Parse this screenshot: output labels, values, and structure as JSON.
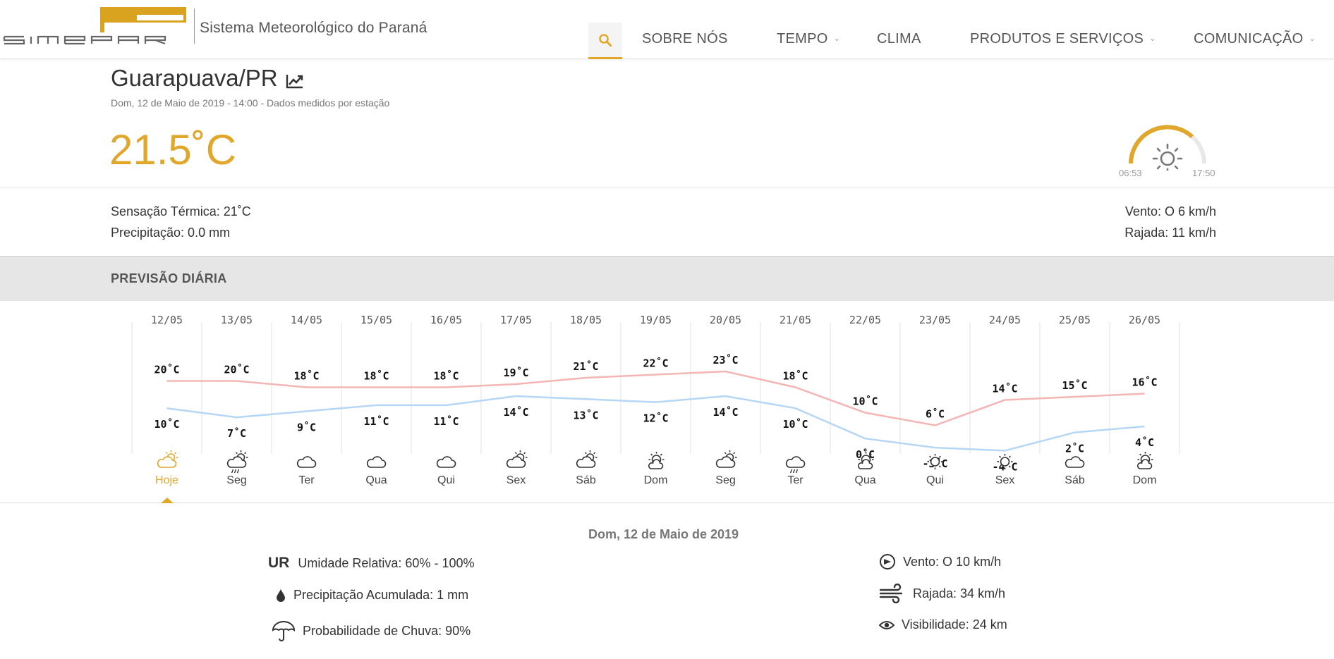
{
  "header": {
    "logo_text": "SIMEPAR",
    "logo_subtitle": "Sistema Meteorológico do Paraná",
    "nav": [
      {
        "label": "SOBRE NÓS",
        "dropdown": false
      },
      {
        "label": "TEMPO",
        "dropdown": true
      },
      {
        "label": "CLIMA",
        "dropdown": false
      },
      {
        "label": "PRODUTOS E SERVIÇOS",
        "dropdown": true
      },
      {
        "label": "COMUNICAÇÃO",
        "dropdown": true
      }
    ],
    "accent_color": "#e0a72b"
  },
  "current": {
    "city": "Guarapuava/PR",
    "subtitle": "Dom, 12 de Maio de 2019 - 14:00 - Dados medidos por estação",
    "temperature": "21.5˚C",
    "sunrise": "06:53",
    "sunset": "17:50",
    "sun_icon": "sun-icon",
    "feels_like": "Sensação Térmica: 21˚C",
    "precipitation": "Precipitação: 0.0 mm",
    "wind": "Vento: O 6 km/h",
    "gust": "Rajada: 11 km/h"
  },
  "forecast": {
    "title": "PREVISÃO DIÁRIA",
    "days": [
      {
        "date": "12/05",
        "max": "20˚C",
        "min": "10˚C",
        "label": "Hoje",
        "icon": "partly-cloudy-icon",
        "selected": true
      },
      {
        "date": "13/05",
        "max": "20˚C",
        "min": "7˚C",
        "label": "Seg",
        "icon": "sun-cloud-rain-icon",
        "selected": false
      },
      {
        "date": "14/05",
        "max": "18˚C",
        "min": "9˚C",
        "label": "Ter",
        "icon": "cloud-icon",
        "selected": false
      },
      {
        "date": "15/05",
        "max": "18˚C",
        "min": "11˚C",
        "label": "Qua",
        "icon": "cloud-icon",
        "selected": false
      },
      {
        "date": "16/05",
        "max": "18˚C",
        "min": "11˚C",
        "label": "Qui",
        "icon": "cloud-icon",
        "selected": false
      },
      {
        "date": "17/05",
        "max": "19˚C",
        "min": "14˚C",
        "label": "Sex",
        "icon": "partly-cloudy-icon",
        "selected": false
      },
      {
        "date": "18/05",
        "max": "21˚C",
        "min": "13˚C",
        "label": "Sáb",
        "icon": "partly-cloudy-icon",
        "selected": false
      },
      {
        "date": "19/05",
        "max": "22˚C",
        "min": "12˚C",
        "label": "Dom",
        "icon": "sun-behind-cloud-icon",
        "selected": false
      },
      {
        "date": "20/05",
        "max": "23˚C",
        "min": "14˚C",
        "label": "Seg",
        "icon": "partly-cloudy-icon",
        "selected": false
      },
      {
        "date": "21/05",
        "max": "18˚C",
        "min": "10˚C",
        "label": "Ter",
        "icon": "cloud-rain-icon",
        "selected": false
      },
      {
        "date": "22/05",
        "max": "10˚C",
        "min": "0˚C",
        "label": "Qua",
        "icon": "sun-behind-cloud-icon",
        "selected": false
      },
      {
        "date": "23/05",
        "max": "6˚C",
        "min": "-3˚C",
        "label": "Qui",
        "icon": "sun-icon",
        "selected": false
      },
      {
        "date": "24/05",
        "max": "14˚C",
        "min": "-4˚C",
        "label": "Sex",
        "icon": "sun-icon",
        "selected": false
      },
      {
        "date": "25/05",
        "max": "15˚C",
        "min": "2˚C",
        "label": "Sáb",
        "icon": "cloud-icon",
        "selected": false
      },
      {
        "date": "26/05",
        "max": "16˚C",
        "min": "4˚C",
        "label": "Dom",
        "icon": "sun-behind-cloud-icon",
        "selected": false
      }
    ],
    "max_color": "#f4b5b5",
    "min_color": "#b5d6f4"
  },
  "chart_data": {
    "type": "line",
    "categories": [
      "12/05",
      "13/05",
      "14/05",
      "15/05",
      "16/05",
      "17/05",
      "18/05",
      "19/05",
      "20/05",
      "21/05",
      "22/05",
      "23/05",
      "24/05",
      "25/05",
      "26/05"
    ],
    "series": [
      {
        "values": [
          20,
          20,
          18,
          18,
          18,
          19,
          21,
          22,
          23,
          18,
          10,
          6,
          14,
          15,
          16
        ]
      },
      {
        "values": [
          10,
          7,
          9,
          11,
          11,
          14,
          13,
          12,
          14,
          10,
          0,
          -3,
          -4,
          2,
          4
        ]
      }
    ]
  },
  "day_detail": {
    "title": "Dom, 12 de Maio de 2019",
    "ur_label": "UR",
    "humidity": "Umidade Relativa: 60% - 100%",
    "precip_acc": "Precipitação Acumulada: 1 mm",
    "rain_prob": "Probabilidade de Chuva: 90%",
    "wind": "Vento: O 10 km/h",
    "gust": "Rajada: 34 km/h",
    "visibility": "Visibilidade: 24 km"
  }
}
